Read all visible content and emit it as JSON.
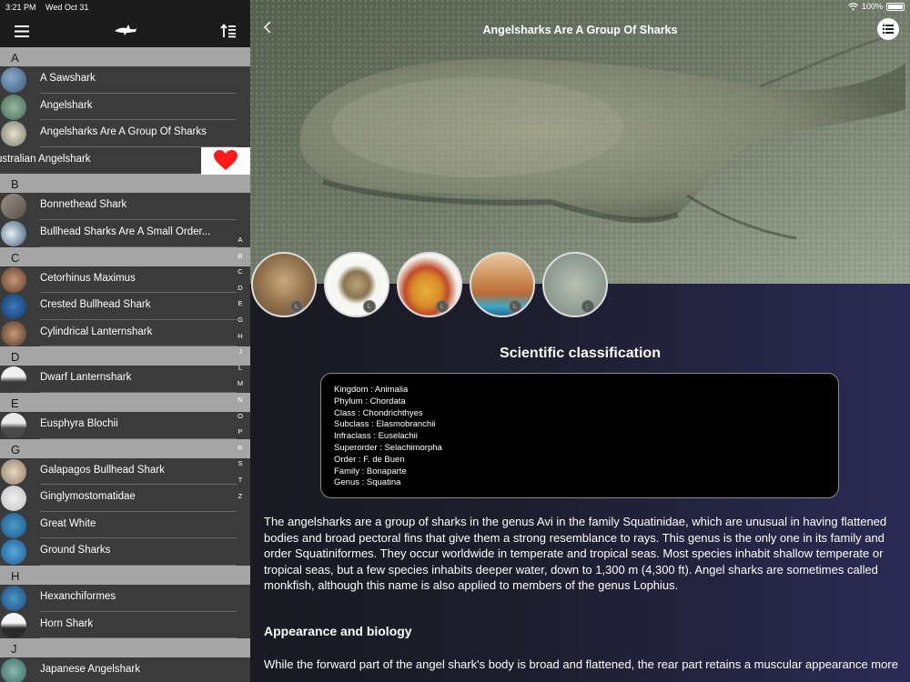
{
  "status": {
    "time": "3:21 PM",
    "date": "Wed Oct 31",
    "battery": "100%"
  },
  "sidebar": {
    "sections": [
      {
        "letter": "A",
        "items": [
          {
            "label": "A Sawshark"
          },
          {
            "label": "Angelshark"
          },
          {
            "label": "Angelsharks Are A Group Of Sharks"
          },
          {
            "label": "ustralian Angelshark",
            "swiped": true
          }
        ]
      },
      {
        "letter": "B",
        "items": [
          {
            "label": "Bonnethead Shark"
          },
          {
            "label": "Bullhead Sharks Are A Small Order..."
          }
        ]
      },
      {
        "letter": "C",
        "items": [
          {
            "label": "Cetorhinus Maximus"
          },
          {
            "label": "Crested Bullhead Shark"
          },
          {
            "label": "Cylindrical Lanternshark"
          }
        ]
      },
      {
        "letter": "D",
        "items": [
          {
            "label": "Dwarf Lanternshark"
          }
        ]
      },
      {
        "letter": "E",
        "items": [
          {
            "label": "Eusphyra Blochii"
          }
        ]
      },
      {
        "letter": "G",
        "items": [
          {
            "label": "Galapagos Bullhead Shark"
          },
          {
            "label": "Ginglymostomatidae"
          },
          {
            "label": "Great White"
          },
          {
            "label": "Ground Sharks"
          }
        ]
      },
      {
        "letter": "H",
        "items": [
          {
            "label": "Hexanchiformes"
          },
          {
            "label": "Horn Shark"
          }
        ]
      },
      {
        "letter": "J",
        "items": [
          {
            "label": "Japanese Angelshark"
          }
        ]
      }
    ],
    "index": [
      "A",
      "B",
      "C",
      "D",
      "E",
      "G",
      "H",
      "J",
      "L",
      "M",
      "N",
      "O",
      "P",
      "R",
      "S",
      "T",
      "Z"
    ]
  },
  "detail": {
    "title": "Angelsharks Are A Group Of Sharks",
    "gallery_badges": [
      "L",
      "L",
      "L",
      "L",
      "L"
    ],
    "classification_title": "Scientific classification",
    "classification": [
      "Kingdom : Animalia",
      "Phylum : Chordata",
      "Class : Chondrichthyes",
      "Subclass : Elasmobranchii",
      "Infraclass : Euselachii",
      "Superorder : Selachimorpha",
      "Order : F. de Buen",
      "Family : Bonaparte",
      "Genus : Squatina"
    ],
    "description": "The angelsharks are a group of sharks in the genus Avi in the family Squatinidae, which are unusual in having flattened bodies and broad pectoral fins that give them a strong resemblance to rays. This genus is the only one in its family and order Squatiniformes. They occur worldwide in temperate and tropical seas. Most species inhabit shallow temperate or tropical seas, but a few species inhabits deeper water, down to 1,300 m (4,300 ft). Angel sharks are sometimes called monkfish, although this name is also applied to members of the genus Lophius.",
    "appearance_title": "Appearance and biology",
    "appearance_text": "While the forward part of the angel shark's body is broad and flattened, the rear part retains a muscular appearance more typical of other sharks. The eyes and spiracles are on top and the five gill slits are on its back. Both the pectorals"
  },
  "colors": {
    "favorite": "#ff1a1a",
    "section_bg": "#a5a5a5",
    "row_bg": "#3b3b3b"
  }
}
